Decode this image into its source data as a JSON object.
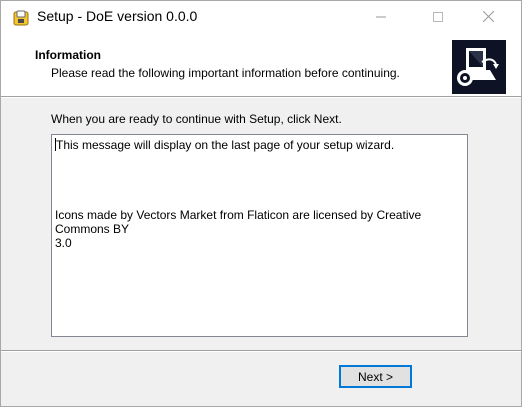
{
  "window": {
    "title": "Setup - DoE version 0.0.0"
  },
  "header": {
    "title": "Information",
    "subtitle": "Please read the following important information before continuing."
  },
  "main": {
    "intro": "When you are ready to continue with Setup, click Next.",
    "memo_lines": [
      "This message will display on the last page of your setup wizard.",
      "",
      "",
      "",
      "",
      "Icons made by Vectors Market from Flaticon are licensed by Creative Commons BY",
      "3.0"
    ]
  },
  "footer": {
    "next_label": "Next >"
  },
  "icons": {
    "app": "setup-app-icon",
    "logo": "installer-computer-icon",
    "minimize": "minimize-icon",
    "maximize": "maximize-icon",
    "close": "close-icon"
  },
  "colors": {
    "accent": "#0078d7",
    "logo_bg": "#0d1325"
  }
}
